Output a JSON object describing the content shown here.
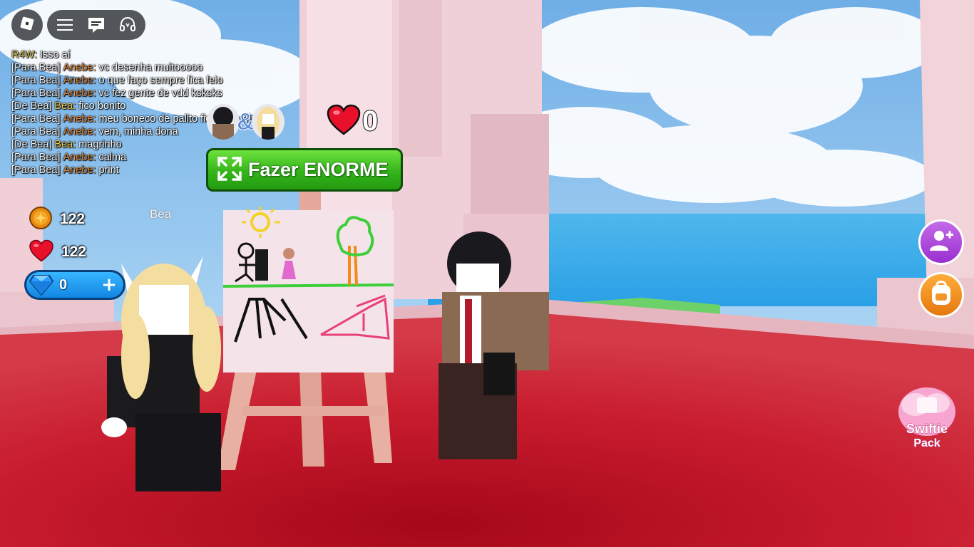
{
  "chat": [
    {
      "prefix": "",
      "speaker": "R4W:",
      "speaker_color": "#d7c15a",
      "message": "Isso aí"
    },
    {
      "prefix": "[Para Bea]",
      "speaker": "Anebe:",
      "speaker_color": "#e08a3c",
      "message": "vc desenha muitooooo"
    },
    {
      "prefix": "[Para Bea]",
      "speaker": "Anebe:",
      "speaker_color": "#e08a3c",
      "message": "o que faço sempre fica feio"
    },
    {
      "prefix": "[Para Bea]",
      "speaker": "Anebe:",
      "speaker_color": "#e08a3c",
      "message": "vc fez gente de vdd ksksks"
    },
    {
      "prefix": "[De Bea]",
      "speaker": "Bea:",
      "speaker_color": "#f3c843",
      "message": "fico bonito"
    },
    {
      "prefix": "[Para Bea]",
      "speaker": "Anebe:",
      "speaker_color": "#e08a3c",
      "message": "meu boneco de palito ficou ate triste"
    },
    {
      "prefix": "[Para Bea]",
      "speaker": "Anebe:",
      "speaker_color": "#e08a3c",
      "message": "vem, minha dona"
    },
    {
      "prefix": "[De Bea]",
      "speaker": "Bea:",
      "speaker_color": "#f3c843",
      "message": "magrinho"
    },
    {
      "prefix": "[Para Bea]",
      "speaker": "Anebe:",
      "speaker_color": "#e08a3c",
      "message": "calma"
    },
    {
      "prefix": "[Para Bea]",
      "speaker": "Anebe:",
      "speaker_color": "#e08a3c",
      "message": "print"
    }
  ],
  "stats": {
    "coins": "122",
    "hearts": "122",
    "gems": "0"
  },
  "likes": "0",
  "big_button_label": "Fazer ENORME",
  "player_name": "Bea",
  "amp": "&",
  "swiftie_pack": {
    "line1": "Swiftie",
    "line2": "Pack"
  },
  "colors": {
    "floor": "#c41a2c",
    "sky": "#7ab6e8",
    "accent_green": "#34b41a",
    "gem_blue": "#1386e4",
    "friend_purple": "#a43ad6",
    "backpack_orange": "#f08a1c"
  },
  "icons": {
    "logo": "roblox-logo-icon",
    "menu": "hamburger-menu-icon",
    "chat": "chat-icon",
    "voice": "headset-icon",
    "coin": "coin-icon",
    "heart": "heart-icon",
    "gem": "diamond-icon",
    "add": "plus-icon",
    "expand": "expand-arrows-icon",
    "add_friend": "add-friend-icon",
    "backpack": "backpack-icon"
  }
}
